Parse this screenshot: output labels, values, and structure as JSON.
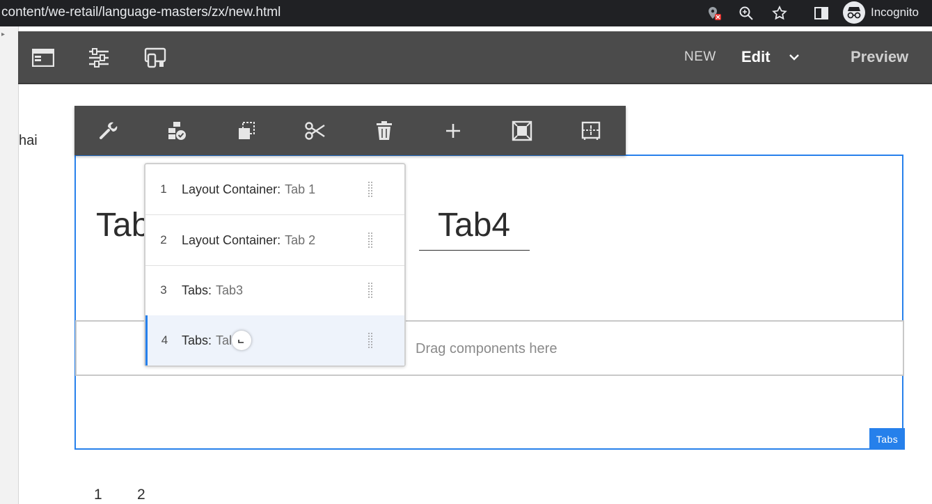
{
  "browser": {
    "address": "content/we-retail/language-masters/zx/new.html",
    "profile_label": "Incognito"
  },
  "editor": {
    "page_label": "NEW",
    "mode_label": "Edit",
    "preview_label": "Preview"
  },
  "page": {
    "side_text": "hai",
    "tab_title_partial": "Tab",
    "tab4_title": "Tab4",
    "drop_text": "Drag components here",
    "component_badge": "Tabs",
    "pagination": [
      "1",
      "2"
    ]
  },
  "tab_order": {
    "items": [
      {
        "index": "1",
        "type": "Layout Container:",
        "name": "Tab 1"
      },
      {
        "index": "2",
        "type": "Layout Container:",
        "name": "Tab 2"
      },
      {
        "index": "3",
        "type": "Tabs:",
        "name": "Tab3"
      },
      {
        "index": "4",
        "type": "Tabs:",
        "name": "Tal"
      }
    ],
    "selected_index": 4
  },
  "toolbar": {
    "buttons": [
      "configure-icon",
      "policy-icon",
      "copy-icon",
      "cut-icon",
      "delete-icon",
      "insert-icon",
      "select-panel-icon",
      "layout-icon"
    ]
  },
  "colors": {
    "accent": "#2680eb",
    "toolbar_bg": "#4b4b4b",
    "browser_bg": "#202124"
  }
}
